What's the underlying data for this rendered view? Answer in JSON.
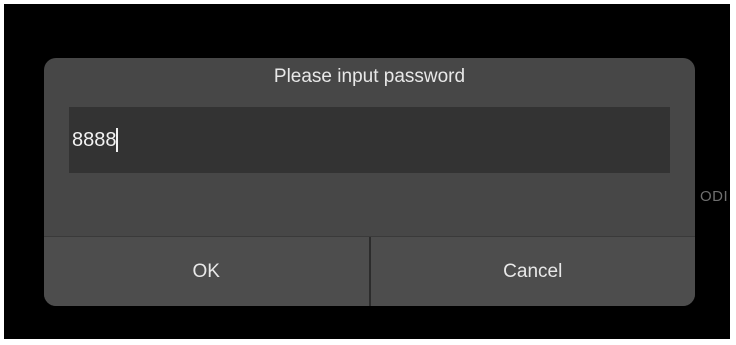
{
  "background": {
    "partial_text": "ODI"
  },
  "dialog": {
    "title": "Please input password",
    "password_value": "8888",
    "ok_label": "OK",
    "cancel_label": "Cancel"
  },
  "colors": {
    "screen": "#000000",
    "dialog": "#474747",
    "field": "#333333",
    "text": "#e8e8e8"
  }
}
